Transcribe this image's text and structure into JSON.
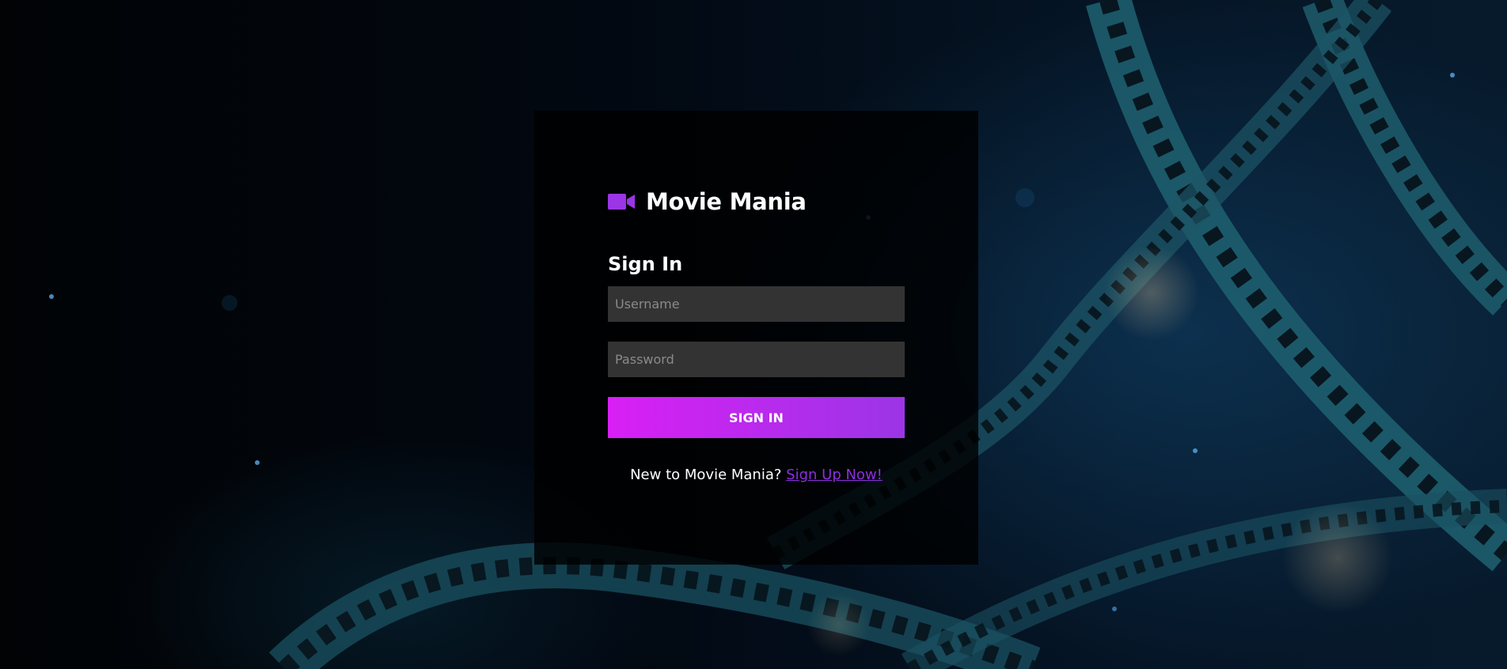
{
  "app": {
    "brand_name": "Movie Mania",
    "brand_icon": "video-camera-icon",
    "accent_color": "#9b35e6"
  },
  "form": {
    "heading": "Sign In",
    "username_placeholder": "Username",
    "password_placeholder": "Password",
    "submit_label": "SIGN IN",
    "gradient_start": "#d91ff5",
    "gradient_end": "#9b35e6"
  },
  "footer": {
    "prompt": "New to Movie Mania?",
    "link_label": "Sign Up Now!"
  },
  "background": {
    "image": "film-reel-icon",
    "colors": [
      "#02060c",
      "#071a2c",
      "#1e5f73"
    ]
  }
}
